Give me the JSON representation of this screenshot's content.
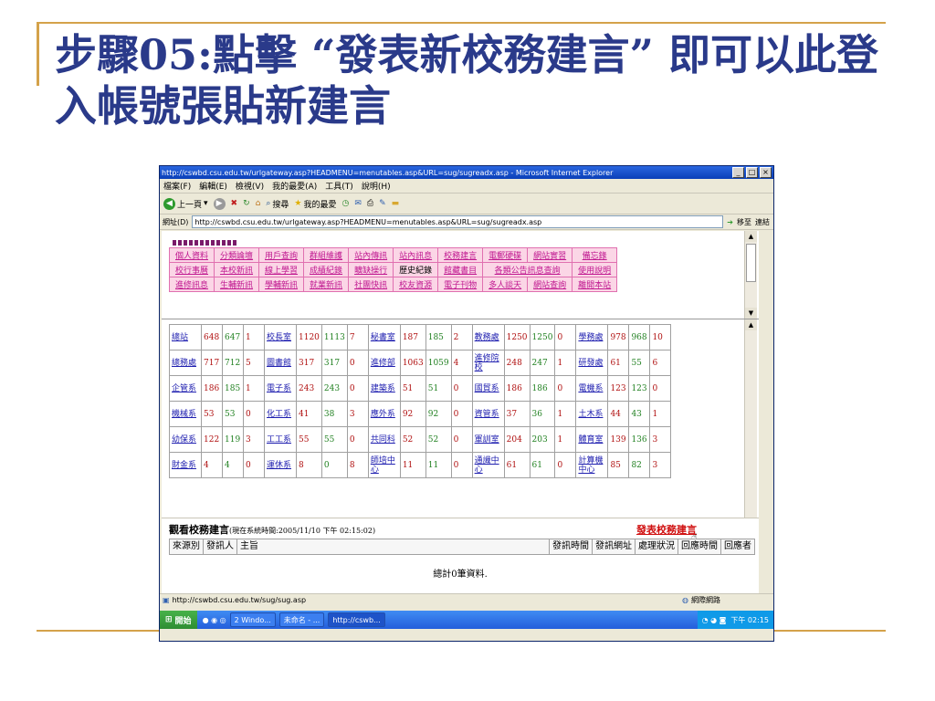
{
  "slide": {
    "title": "步驟05:點擊 “發表新校務建言” 即可以此登入帳號張貼新建言"
  },
  "window": {
    "title": "http://cswbd.csu.edu.tw/urlgateway.asp?HEADMENU=menutables.asp&URL=sug/sugreadx.asp - Microsoft Internet Explorer",
    "menu": [
      "檔案(F)",
      "編輯(E)",
      "檢視(V)",
      "我的最愛(A)",
      "工具(T)",
      "說明(H)"
    ],
    "toolbar": {
      "back": "上一頁",
      "search": "搜尋",
      "favorites": "我的最愛"
    },
    "address_label": "網址(D)",
    "address_value": "http://cswbd.csu.edu.tw/urlgateway.asp?HEADMENU=menutables.asp&URL=sug/sugreadx.asp",
    "go_label": "移至",
    "links_label": "連結"
  },
  "nav_menu": [
    [
      "個人資料",
      "分類論壇",
      "用戶查詢",
      "群組維護",
      "站內傳訊",
      "站內訊息",
      "校務建言",
      "電郵硬碟",
      "網站實習",
      "備忘錄"
    ],
    [
      "校行事曆",
      "本校新訊",
      "線上學習",
      "成績紀錄",
      "曠缺操行",
      "歷史紀錄",
      "館藏書目",
      "各類公告訊息查詢",
      "使用說明"
    ],
    [
      "進修訊息",
      "生輔新訊",
      "學輔新訊",
      "就業新訊",
      "社團快訊",
      "校友資源",
      "電子刊物",
      "多人談天",
      "網站查詢",
      "離開本站"
    ]
  ],
  "stats_rows": [
    [
      [
        "總站",
        "648",
        "647",
        "1"
      ],
      [
        "校長室",
        "1120",
        "1113",
        "7"
      ],
      [
        "秘書室",
        "187",
        "185",
        "2"
      ],
      [
        "教務處",
        "1250",
        "1250",
        "0"
      ],
      [
        "學務處",
        "978",
        "968",
        "10"
      ]
    ],
    [
      [
        "總務處",
        "717",
        "712",
        "5"
      ],
      [
        "圖書館",
        "317",
        "317",
        "0"
      ],
      [
        "進修部",
        "1063",
        "1059",
        "4"
      ],
      [
        "進修院校",
        "248",
        "247",
        "1"
      ],
      [
        "研發處",
        "61",
        "55",
        "6"
      ]
    ],
    [
      [
        "企管系",
        "186",
        "185",
        "1"
      ],
      [
        "電子系",
        "243",
        "243",
        "0"
      ],
      [
        "建築系",
        "51",
        "51",
        "0"
      ],
      [
        "國貿系",
        "186",
        "186",
        "0"
      ],
      [
        "電機系",
        "123",
        "123",
        "0"
      ]
    ],
    [
      [
        "機械系",
        "53",
        "53",
        "0"
      ],
      [
        "化工系",
        "41",
        "38",
        "3"
      ],
      [
        "應外系",
        "92",
        "92",
        "0"
      ],
      [
        "資管系",
        "37",
        "36",
        "1"
      ],
      [
        "土木系",
        "44",
        "43",
        "1"
      ]
    ],
    [
      [
        "幼保系",
        "122",
        "119",
        "3"
      ],
      [
        "工工系",
        "55",
        "55",
        "0"
      ],
      [
        "共同科",
        "52",
        "52",
        "0"
      ],
      [
        "軍訓室",
        "204",
        "203",
        "1"
      ],
      [
        "體育室",
        "139",
        "136",
        "3"
      ]
    ],
    [
      [
        "財金系",
        "4",
        "4",
        "0"
      ],
      [
        "運休系",
        "8",
        "0",
        "8"
      ],
      [
        "師培中心",
        "11",
        "11",
        "0"
      ],
      [
        "通識中心",
        "61",
        "61",
        "0"
      ],
      [
        "計算機中心",
        "85",
        "82",
        "3"
      ]
    ]
  ],
  "suggest": {
    "title": "觀看校務建言",
    "time": "(現在系統時間:2005/11/10 下午 02:15:02)",
    "post_link": "發表校務建言",
    "columns": [
      "來源別",
      "發訊人",
      "主旨",
      "發訊時間",
      "發訊網址",
      "處理狀況",
      "回應時間",
      "回應者"
    ],
    "total": "總計0筆資料."
  },
  "status": {
    "url": "http://cswbd.csu.edu.tw/sug/sug.asp",
    "zone": "網際網路"
  },
  "taskbar": {
    "start": "開始",
    "tasks": [
      "2 Windo...",
      "未命名 - ...",
      "http://cswb..."
    ],
    "clock": "下午 02:15"
  }
}
